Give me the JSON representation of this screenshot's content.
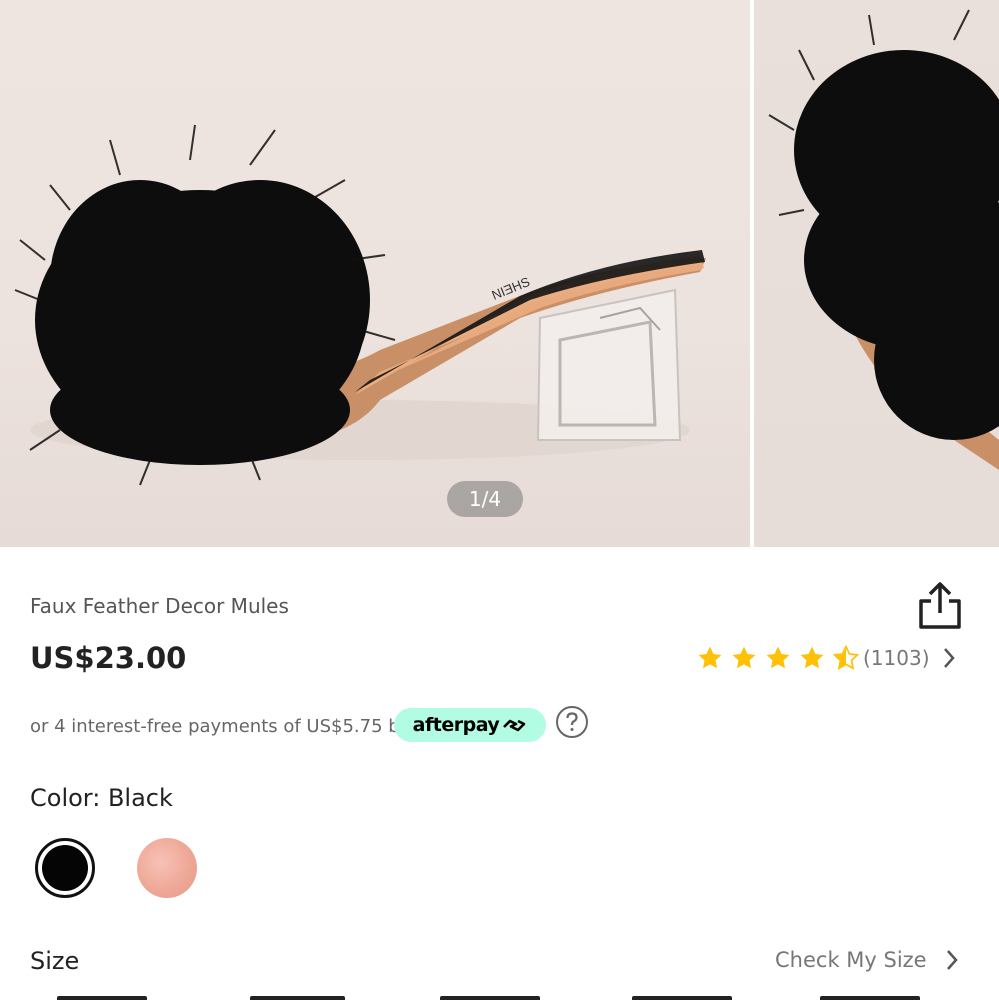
{
  "gallery": {
    "pager": "1/4",
    "current_image": "black faux feather mule with clear block heel",
    "next_image": "black faux feather mule front view"
  },
  "product": {
    "title": "Faux Feather Decor Mules",
    "price": "US$23.00",
    "rating": {
      "stars": 4.5,
      "max": 5,
      "count": "(1103)"
    },
    "installments": "or 4 interest-free payments of US$5.75 by",
    "afterpay_label": "afterpay"
  },
  "color": {
    "label": "Color: Black",
    "options": [
      {
        "name": "Black",
        "selected": true,
        "hex": "#050505"
      },
      {
        "name": "Pink",
        "selected": false,
        "hex": "#eea897"
      }
    ]
  },
  "size": {
    "label": "Size",
    "check_label": "Check My Size"
  },
  "colors": {
    "star": "#ffc107",
    "afterpay_bg": "#b2fce4",
    "text_primary": "#222222",
    "text_secondary": "#777777"
  },
  "icons": [
    "share-icon",
    "star-icon",
    "chevron-right-icon",
    "help-icon",
    "afterpay-logo-icon"
  ]
}
